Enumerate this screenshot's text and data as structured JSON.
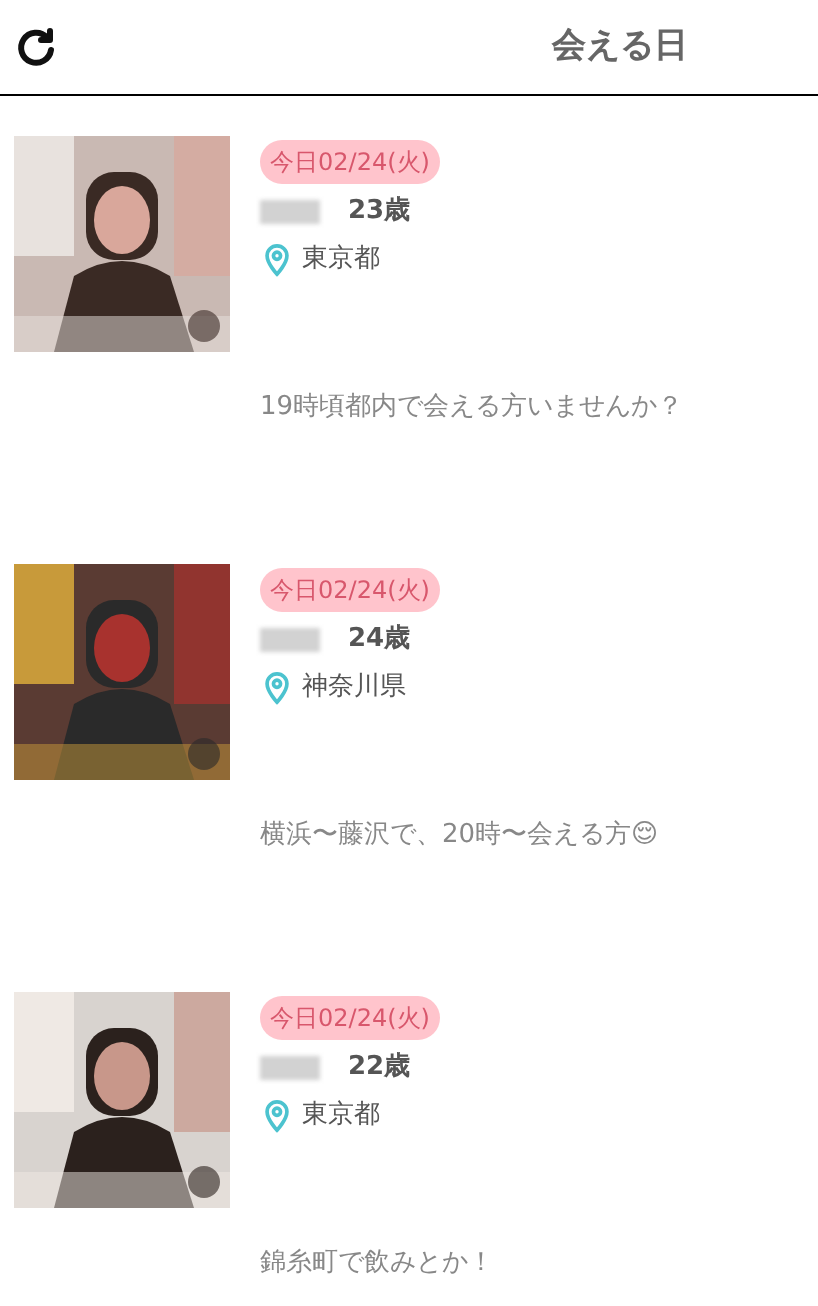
{
  "header": {
    "title": "会える日"
  },
  "posts": [
    {
      "date": "今日02/24(火)",
      "age": "23歳",
      "location": "東京都",
      "message": "19時頃都内で会える方いませんか？"
    },
    {
      "date": "今日02/24(火)",
      "age": "24歳",
      "location": "神奈川県",
      "message": "横浜〜藤沢で、20時〜会える方😌"
    },
    {
      "date": "今日02/24(火)",
      "age": "22歳",
      "location": "東京都",
      "message": "錦糸町で飲みとか！"
    }
  ]
}
